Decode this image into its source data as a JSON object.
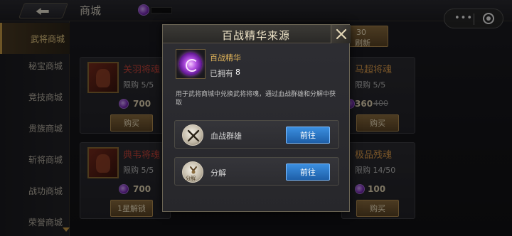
{
  "topbar": {
    "title": "商城"
  },
  "mini_program": {
    "more": "•••"
  },
  "sidebar": {
    "items": [
      {
        "label": "武将商城",
        "active": true
      },
      {
        "label": "秘宝商城"
      },
      {
        "label": "竞技商城"
      },
      {
        "label": "贵族商城"
      },
      {
        "label": "斩将商城"
      },
      {
        "label": "战功商城"
      },
      {
        "label": "荣誉商城"
      }
    ]
  },
  "refresh": {
    "count": "30",
    "label": "刷新"
  },
  "cards": [
    {
      "name": "关羽将魂",
      "quota": "限购 5/5",
      "price": "700",
      "button": "购买"
    },
    {
      "name": "马超将魂",
      "quota": "限购 5/5",
      "price": "360",
      "old_price": "400",
      "button": "购买"
    },
    {
      "name": "典韦将魂",
      "quota": "限购 5/5",
      "price": "700",
      "button": "1星解锁"
    },
    {
      "name": "极品残魂",
      "quota": "限购 14/50",
      "price": "100",
      "button": "购买"
    }
  ],
  "modal": {
    "title": "百战精华来源",
    "item_name": "百战精华",
    "owned_label": "已拥有",
    "owned_count": "8",
    "description": "用于武将商城中兑换武将将魂，通过血战群雄和分解中获取",
    "sources": [
      {
        "label": "血战群雄",
        "button": "前往",
        "icon": "crossed-swords-icon"
      },
      {
        "label": "分解",
        "button": "前往",
        "icon": "decompose-icon",
        "icon_text": "分解"
      }
    ]
  },
  "colors": {
    "accent_gold": "#c99b45",
    "go_button_blue": "#2b76c8",
    "item_purple": "#b04de0"
  }
}
